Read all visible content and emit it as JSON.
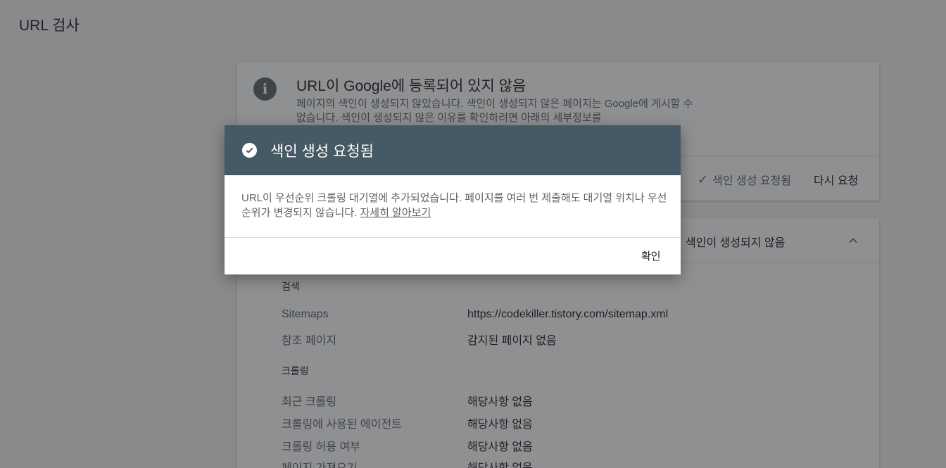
{
  "page": {
    "title": "URL 검사"
  },
  "status_card": {
    "heading": "URL이 Google에 등록되어 있지 않음",
    "description": "페이지의 색인이 생성되지 않았습니다. 색인이 생성되지 않은 페이지는 Google에 게시할 수 없습니다. 색인이 생성되지 않은 이유를 확인하려면 아래의 세부정보를",
    "requested_label": "색인 생성 요청됨",
    "re_request_label": "다시 요청"
  },
  "coverage_card": {
    "title": "색인이 생성되지 않음",
    "discovery": {
      "heading": "검색",
      "rows": [
        {
          "label": "Sitemaps",
          "value": "https://codekiller.tistory.com/sitemap.xml"
        },
        {
          "label": "참조 페이지",
          "value": "감지된 페이지 없음"
        }
      ]
    },
    "crawl": {
      "heading": "크롤링",
      "rows": [
        {
          "label": "최근 크롤링",
          "value": "해당사항 없음"
        },
        {
          "label": "크롤링에 사용된 에이전트",
          "value": "해당사항 없음"
        },
        {
          "label": "크롤링 허용 여부",
          "value": "해당사항 없음"
        },
        {
          "label": "페이지 가져오기",
          "value": "해당사항 없음"
        }
      ]
    }
  },
  "dialog": {
    "title": "색인 생성 요청됨",
    "body": "URL이 우선순위 크롤링 대기열에 추가되었습니다. 페이지를 여러 번 제출해도 대기열 위치나 우선순위가 변경되지 않습니다.",
    "learn_more": "자세히 알아보기",
    "confirm_label": "확인"
  },
  "colors": {
    "dialog_header": "#455a64",
    "scrim": "rgba(32,33,36,0.5)",
    "page_background": "#f1f3f4"
  },
  "icons": [
    "info-icon",
    "check-icon",
    "chevron-up-icon",
    "check-circle-icon"
  ]
}
